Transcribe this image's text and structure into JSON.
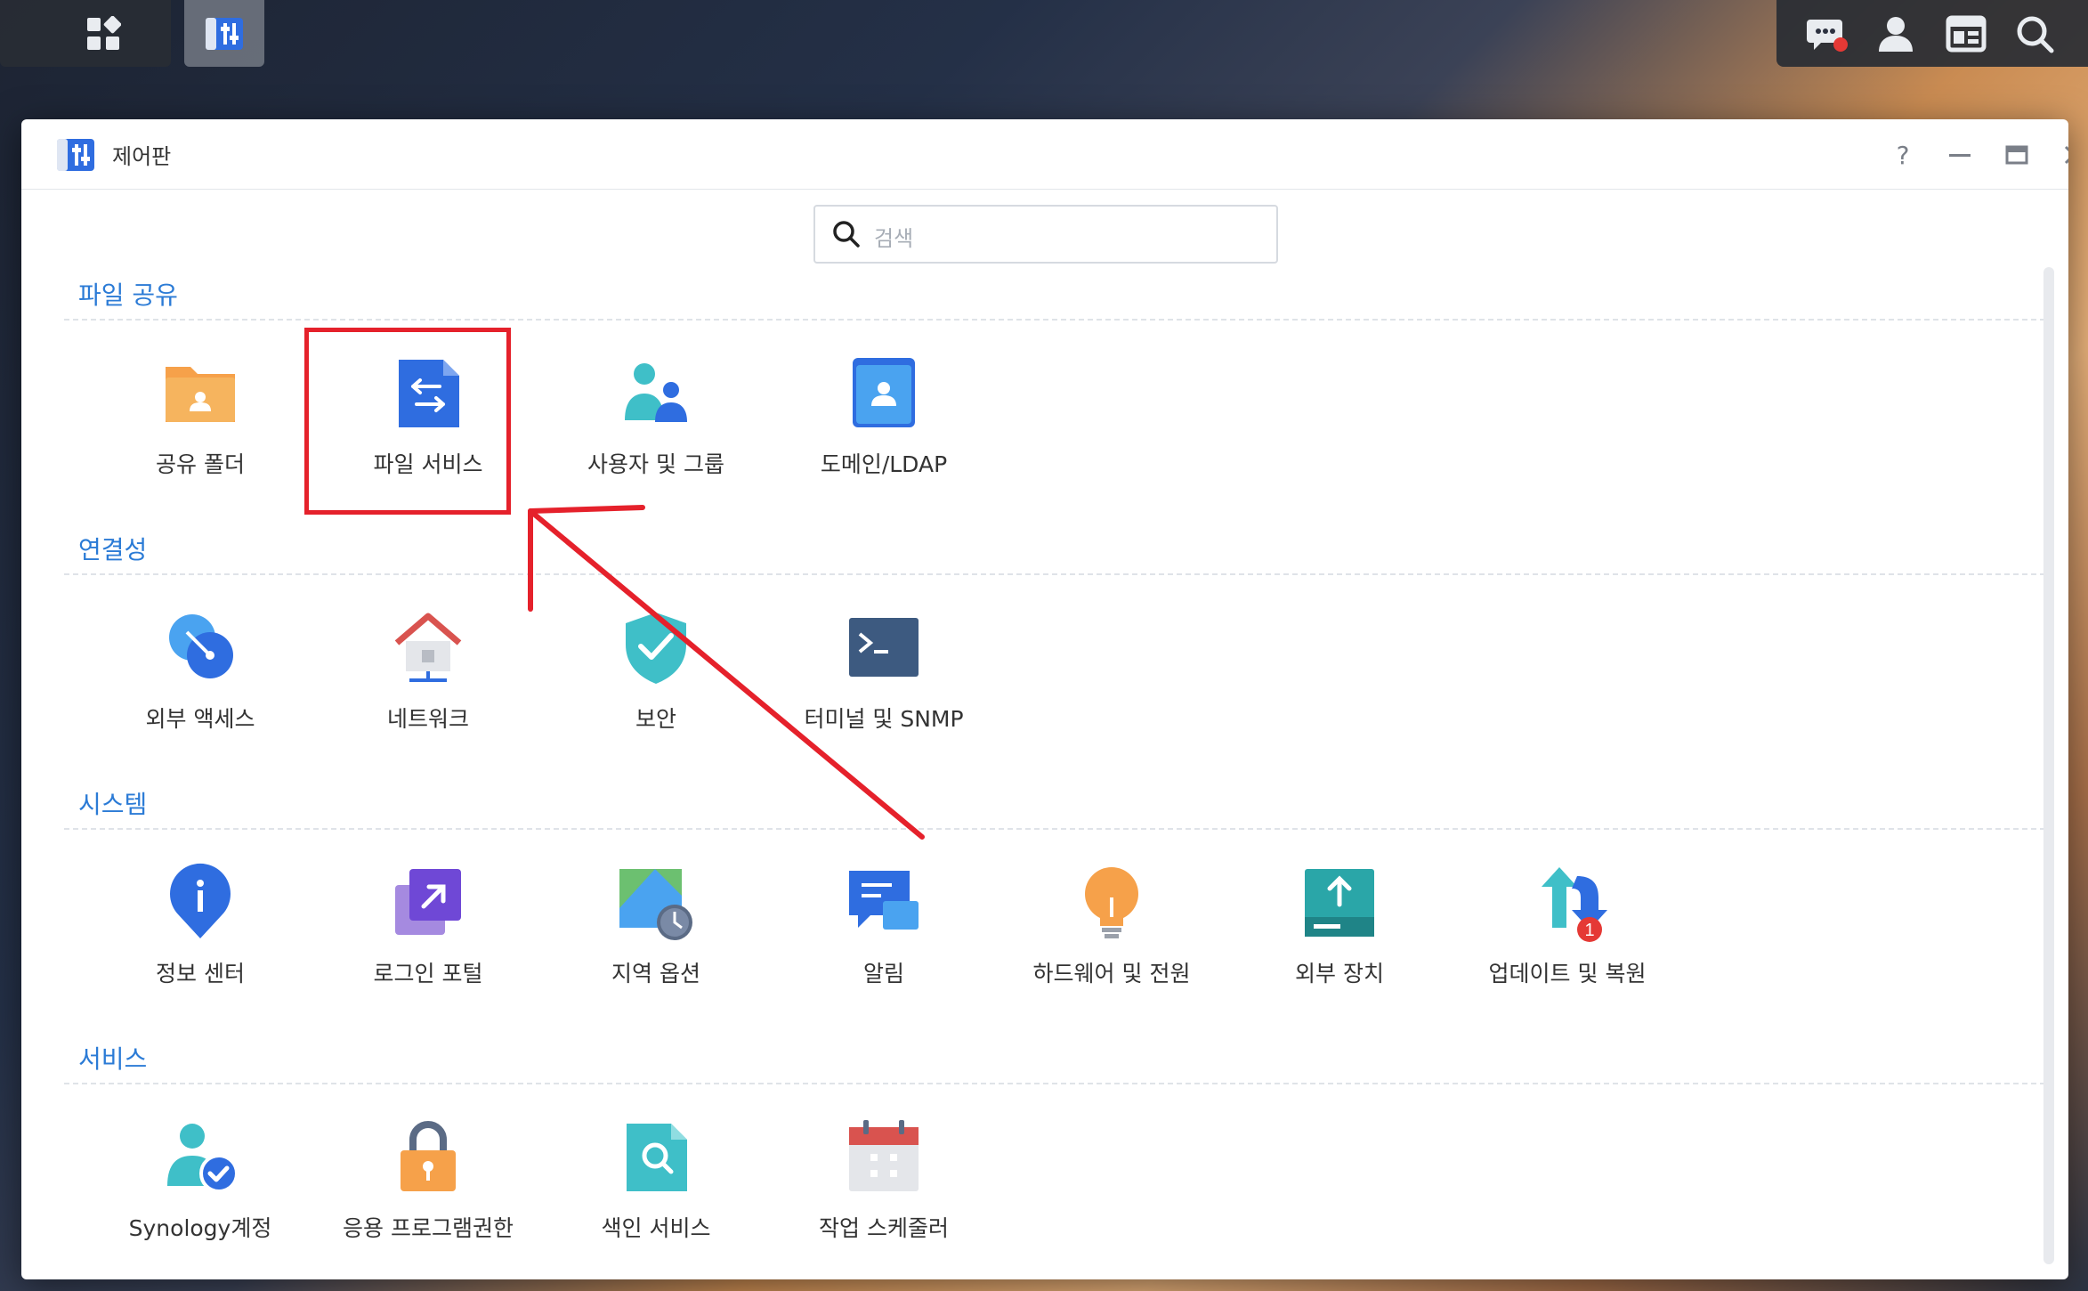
{
  "window": {
    "title": "제어판"
  },
  "search": {
    "placeholder": "검색"
  },
  "sections": [
    {
      "title": "파일 공유",
      "items": [
        "공유 폴더",
        "파일 서비스",
        "사용자 및 그룹",
        "도메인/LDAP"
      ]
    },
    {
      "title": "연결성",
      "items": [
        "외부 액세스",
        "네트워크",
        "보안",
        "터미널 및 SNMP"
      ]
    },
    {
      "title": "시스템",
      "items": [
        "정보 센터",
        "로그인 포털",
        "지역 옵션",
        "알림",
        "하드웨어 및 전원",
        "외부 장치",
        "업데이트 및 복원"
      ]
    },
    {
      "title": "서비스",
      "items": [
        "Synology계정",
        "응용 프로그램권한",
        "색인 서비스",
        "작업 스케줄러"
      ]
    }
  ],
  "badges": {
    "update_count": "1"
  },
  "colors": {
    "accent": "#2b7bd6",
    "highlight": "#e5212b",
    "badge": "#e53935"
  },
  "icons": {
    "taskbar_left": [
      "grid-icon",
      "control-panel-icon"
    ],
    "taskbar_right": [
      "chat-icon",
      "user-icon",
      "widget-icon",
      "search-icon"
    ],
    "window_controls": [
      "help-icon",
      "minimize-icon",
      "maximize-icon",
      "close-icon"
    ]
  }
}
